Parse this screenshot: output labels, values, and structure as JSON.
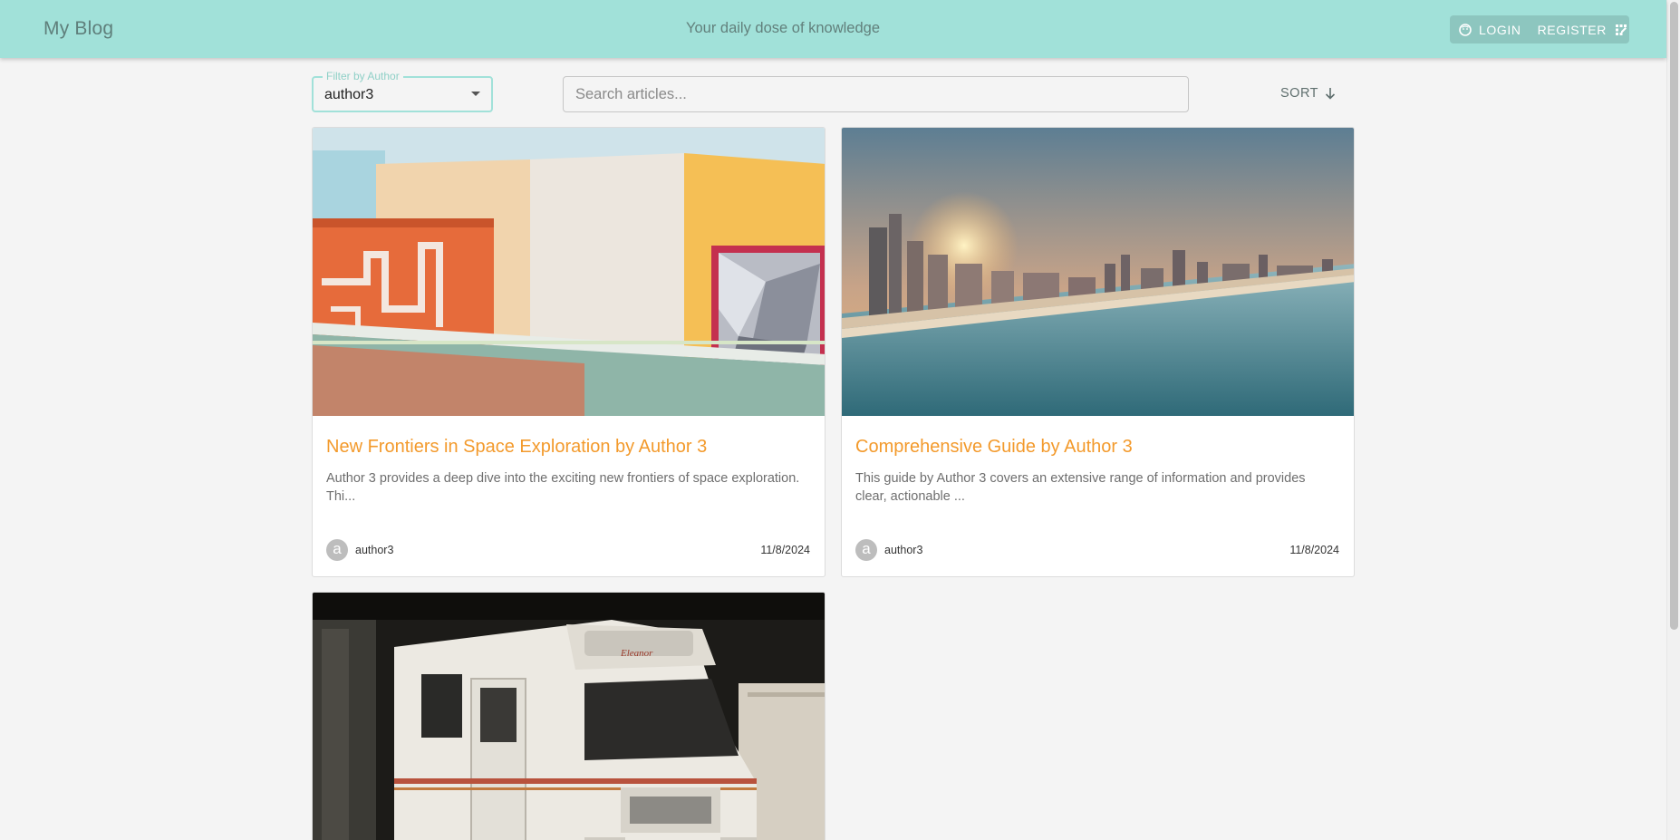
{
  "header": {
    "brand": "My Blog",
    "tagline": "Your daily dose of knowledge",
    "login_label": "LOGIN",
    "register_label": "REGISTER"
  },
  "toolbar": {
    "filter_label": "Filter by Author",
    "filter_value": "author3",
    "search_placeholder": "Search articles...",
    "sort_label": "SORT"
  },
  "colors": {
    "header_bg": "#a1e1d9",
    "accent_title": "#f39a2c",
    "page_bg": "#f4f4f4"
  },
  "articles": [
    {
      "title": "New Frontiers in Space Exploration by Author 3",
      "excerpt": "Author 3 provides a deep dive into the exciting new frontiers of space exploration. Thi...",
      "avatar_letter": "a",
      "author": "author3",
      "date": "11/8/2024",
      "image": "colorful-building-photo"
    },
    {
      "title": "Comprehensive Guide by Author 3",
      "excerpt": "This guide by Author 3 covers an extensive range of information and provides clear, actionable ...",
      "avatar_letter": "a",
      "author": "author3",
      "date": "11/8/2024",
      "image": "coastal-city-sunset-photo"
    },
    {
      "image": "white-camper-van-photo"
    }
  ]
}
